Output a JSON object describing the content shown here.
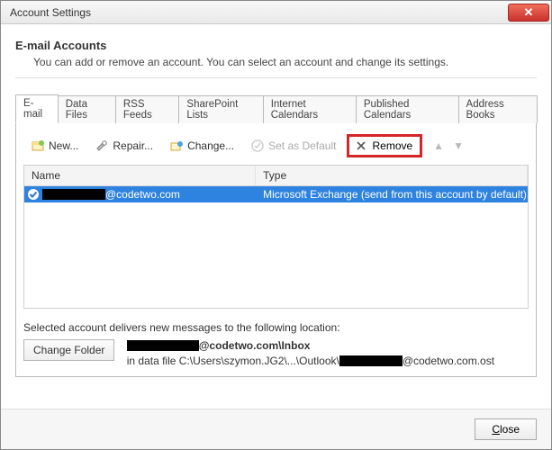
{
  "window": {
    "title": "Account Settings"
  },
  "section": {
    "title": "E-mail Accounts",
    "desc": "You can add or remove an account. You can select an account and change its settings."
  },
  "tabs": {
    "email": "E-mail",
    "dataFiles": "Data Files",
    "rss": "RSS Feeds",
    "sharepoint": "SharePoint Lists",
    "internetCals": "Internet Calendars",
    "publishedCals": "Published Calendars",
    "addressBooks": "Address Books"
  },
  "toolbar": {
    "new": "New...",
    "repair": "Repair...",
    "change": "Change...",
    "setDefault": "Set as Default",
    "remove": "Remove"
  },
  "list": {
    "colName": "Name",
    "colType": "Type",
    "rows": [
      {
        "nameSuffix": "@codetwo.com",
        "type": "Microsoft Exchange (send from this account by default)"
      }
    ]
  },
  "location": {
    "intro": "Selected account delivers new messages to the following location:",
    "changeFolder": "Change Folder",
    "line1Suffix": "@codetwo.com\\Inbox",
    "line2Prefix": "in data file C:\\Users\\szymon.JG2\\...\\Outlook\\",
    "line2Suffix": "@codetwo.com.ost"
  },
  "footer": {
    "close": "Close"
  }
}
